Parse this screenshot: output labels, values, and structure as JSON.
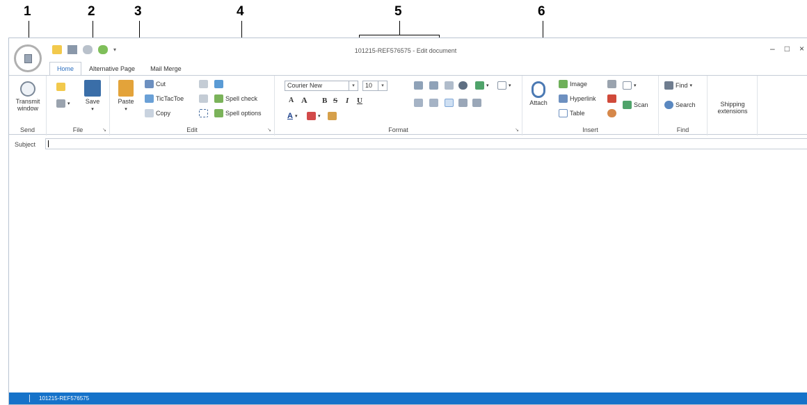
{
  "callouts": {
    "c1": "1",
    "c2": "2",
    "c3": "3",
    "c4": "4",
    "c5": "5",
    "c6": "6"
  },
  "window": {
    "title": "101215-REF576575 - Edit document",
    "minimize": "–",
    "maximize": "□",
    "close": "×"
  },
  "quick_access_icons": [
    "folder-icon",
    "save-icon",
    "undo-icon",
    "refresh-icon",
    "customize-dropdown-icon"
  ],
  "tabs": [
    {
      "label": "Home"
    },
    {
      "label": "Alternative Page"
    },
    {
      "label": "Mail Merge"
    }
  ],
  "ribbon": {
    "send": {
      "label": "Send",
      "transmit": "Transmit window"
    },
    "file": {
      "label": "File",
      "save": "Save"
    },
    "edit": {
      "label": "Edit",
      "paste": "Paste",
      "cut": "Cut",
      "tictactoe": "TicTacToe",
      "copy": "Copy",
      "spell_check": "Spell check",
      "spell_options": "Spell options"
    },
    "format": {
      "label": "Format",
      "font": "Courier New",
      "size": "10",
      "bold": "B",
      "italic": "I",
      "underline": "U",
      "strike": "S",
      "grow": "A",
      "shrink": "A"
    },
    "insert": {
      "label": "Insert",
      "attach": "Attach",
      "image": "Image",
      "hyperlink": "Hyperlink",
      "table": "Table",
      "scan": "Scan"
    },
    "find": {
      "label": "Find",
      "find": "Find",
      "search": "Search"
    },
    "shipping": {
      "label": "Shipping extensions"
    }
  },
  "subject": {
    "label": "Subject",
    "value": ""
  },
  "status": {
    "text": "101215-REF576575"
  },
  "colors": {
    "accent": "#1572c9",
    "tab_active": "#2a6ebf"
  }
}
